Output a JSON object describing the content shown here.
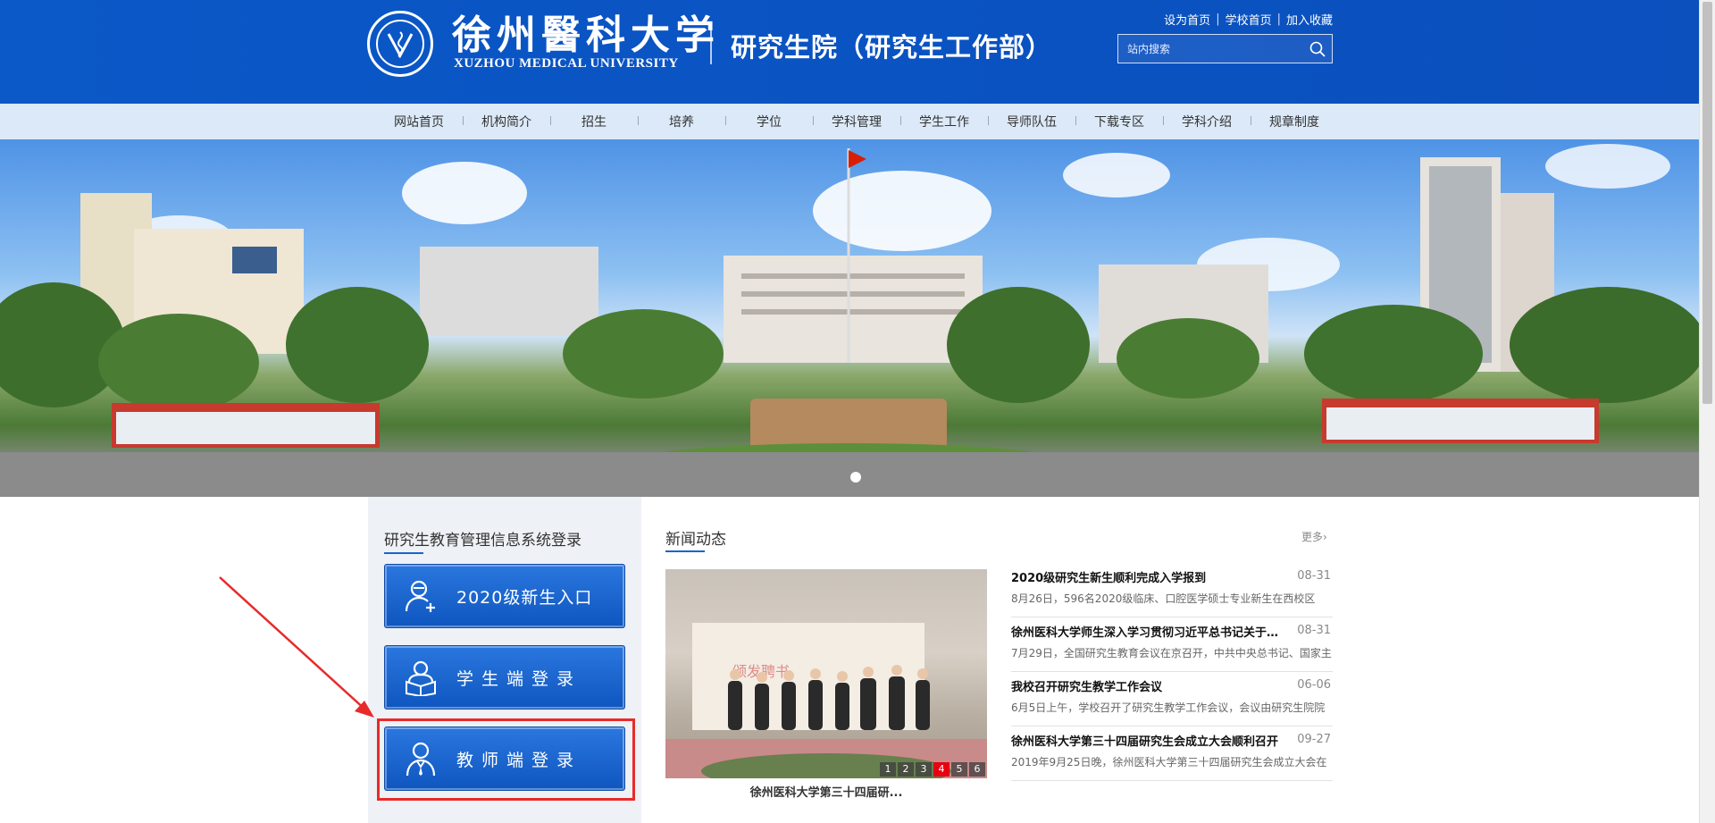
{
  "header": {
    "school_name_cn": "徐州醫科大学",
    "school_name_en": "XUZHOU MEDICAL UNIVERSITY",
    "department": "研究生院（研究生工作部）",
    "top_links": [
      "设为首页",
      "学校首页",
      "加入收藏"
    ],
    "search_placeholder": "站内搜索"
  },
  "nav": {
    "items": [
      "网站首页",
      "机构简介",
      "招生",
      "培养",
      "学位",
      "学科管理",
      "学生工作",
      "导师队伍",
      "下载专区",
      "学科介绍",
      "规章制度"
    ]
  },
  "login": {
    "title": "研究生教育管理信息系统登录",
    "buttons": [
      {
        "label": "2020级新生入口",
        "icon": "user-add-icon"
      },
      {
        "label": "学生端登录",
        "icon": "student-reading-icon"
      },
      {
        "label": "教师端登录",
        "icon": "teacher-icon"
      }
    ]
  },
  "news": {
    "title": "新闻动态",
    "more": "更多›",
    "photo_caption": "徐州医科大学第三十四届研...",
    "slide_numbers": [
      "1",
      "2",
      "3",
      "4",
      "5",
      "6"
    ],
    "active_slide": "4",
    "items": [
      {
        "title": "2020级研究生新生顺利完成入学报到",
        "date": "08-31",
        "summary": "8月26日，596名2020级临床、口腔医学硕士专业新生在西校区"
      },
      {
        "title": "徐州医科大学师生深入学习贯彻习近平总书记关于研...",
        "date": "08-31",
        "summary": "7月29日，全国研究生教育会议在京召开，中共中央总书记、国家主"
      },
      {
        "title": "我校召开研究生教学工作会议",
        "date": "06-06",
        "summary": "6月5日上午，学校召开了研究生教学工作会议，会议由研究生院院"
      },
      {
        "title": "徐州医科大学第三十四届研究生会成立大会顺利召开",
        "date": "09-27",
        "summary": "2019年9月25日晚，徐州医科大学第三十四届研究生会成立大会在"
      }
    ]
  },
  "colors": {
    "header_blue": "#0b55c5",
    "nav_bg": "#dbe9f8",
    "button_blue": "#1a63cf",
    "highlight_red": "#e82a2a",
    "active_slide_red": "#e60012"
  }
}
